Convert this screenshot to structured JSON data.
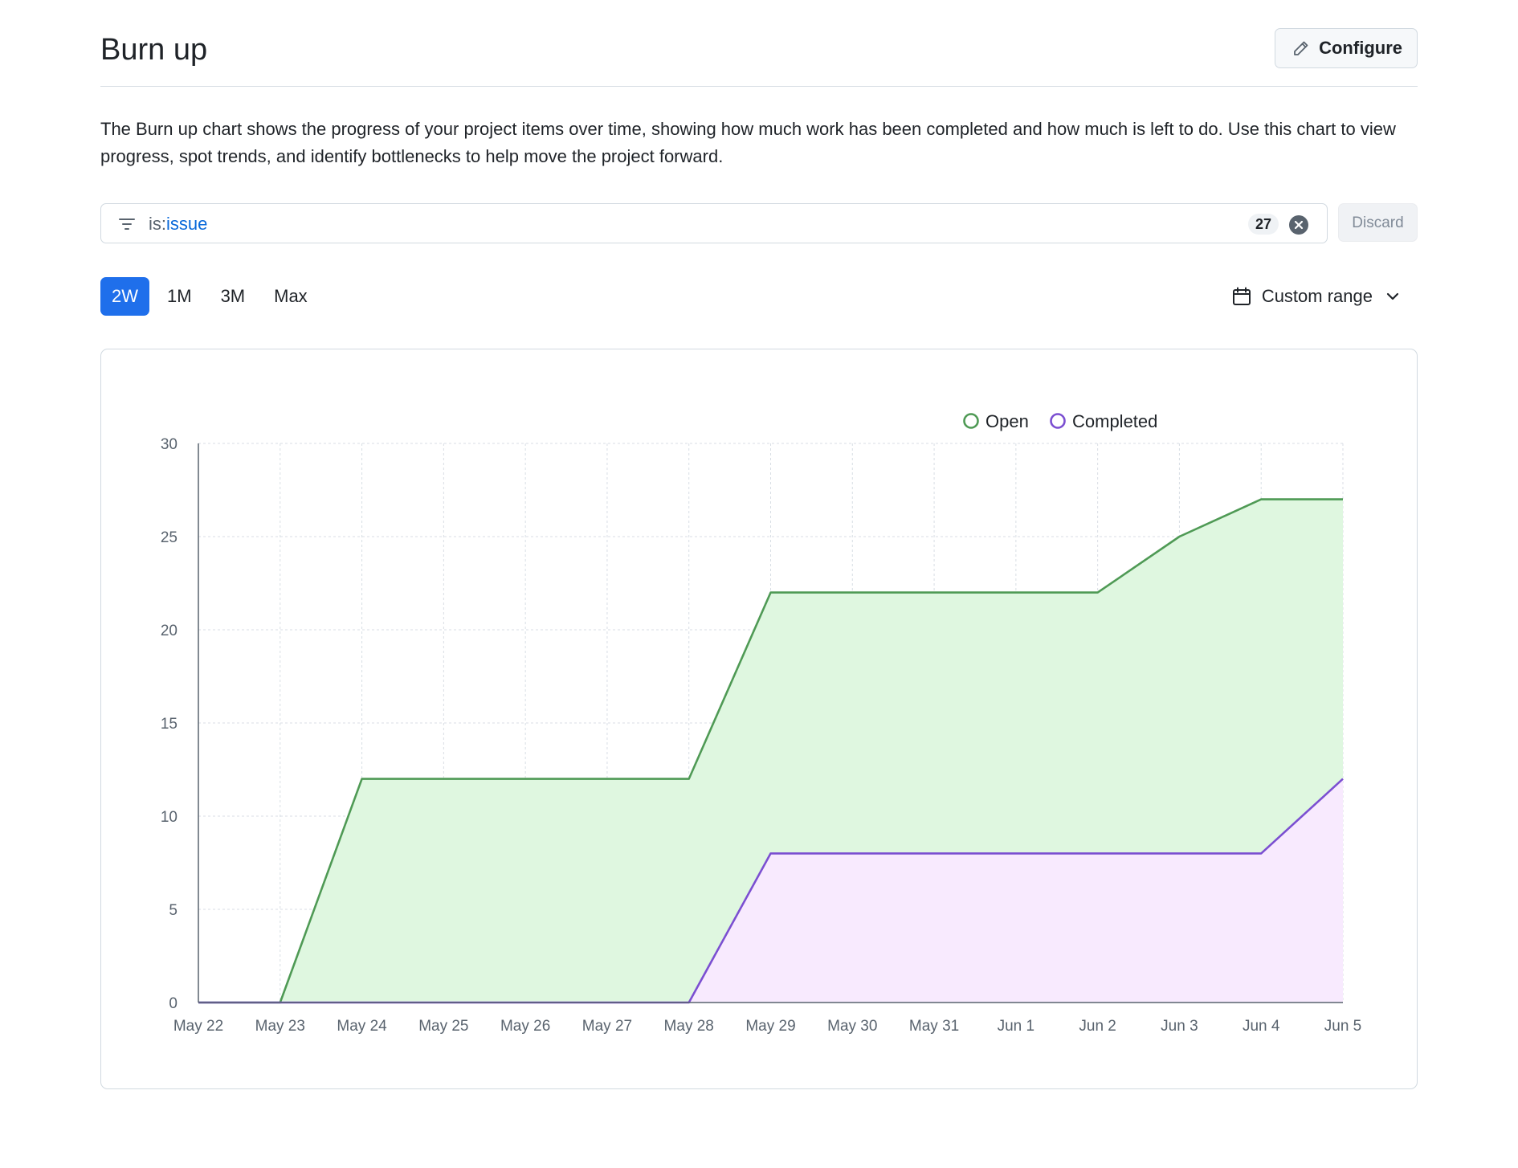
{
  "header": {
    "title": "Burn up",
    "configure_label": "Configure"
  },
  "description": "The Burn up chart shows the progress of your project items over time, showing how much work has been completed and how much is left to do. Use this chart to view progress, spot trends, and identify bottlenecks to help move the project forward.",
  "filter": {
    "key": "is:",
    "value": "issue",
    "count": "27",
    "discard_label": "Discard"
  },
  "range_tabs": [
    {
      "label": "2W",
      "active": true
    },
    {
      "label": "1M",
      "active": false
    },
    {
      "label": "3M",
      "active": false
    },
    {
      "label": "Max",
      "active": false
    }
  ],
  "custom_range_label": "Custom range",
  "icons": [
    "pencil-icon",
    "filter-icon",
    "x-circle-icon",
    "calendar-icon",
    "chevron-down-icon"
  ],
  "colors": {
    "accent": "#1f6feb",
    "open_line": "#4f9a55",
    "open_fill": "#dff7e0",
    "completed_line": "#7b4fd1",
    "completed_fill": "#f8eafe"
  },
  "chart_data": {
    "type": "area",
    "x": [
      "May 22",
      "May 23",
      "May 24",
      "May 25",
      "May 26",
      "May 27",
      "May 28",
      "May 29",
      "May 30",
      "May 31",
      "Jun 1",
      "Jun 2",
      "Jun 3",
      "Jun 4",
      "Jun 5"
    ],
    "series": [
      {
        "name": "Open",
        "values": [
          0,
          0,
          12,
          12,
          12,
          12,
          12,
          22,
          22,
          22,
          22,
          22,
          25,
          27,
          27
        ]
      },
      {
        "name": "Completed",
        "values": [
          0,
          0,
          0,
          0,
          0,
          0,
          0,
          8,
          8,
          8,
          8,
          8,
          8,
          8,
          12
        ]
      }
    ],
    "yticks": [
      0,
      5,
      10,
      15,
      20,
      25,
      30
    ],
    "ylim": [
      0,
      30
    ],
    "grid": true,
    "legend_position": "top-right",
    "title": "",
    "xlabel": "",
    "ylabel": ""
  }
}
